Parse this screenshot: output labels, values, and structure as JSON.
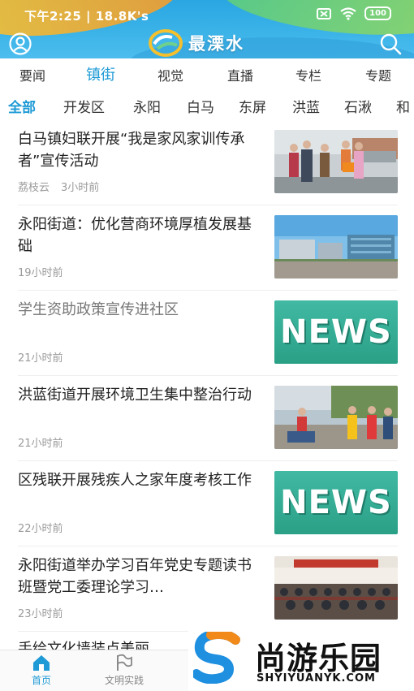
{
  "status": {
    "text": "下午2:25 | 18.8K's",
    "battery": "100"
  },
  "brand": {
    "name": "最溧水"
  },
  "channels": [
    {
      "label": "要闻"
    },
    {
      "label": "镇街"
    },
    {
      "label": "视觉"
    },
    {
      "label": "直播"
    },
    {
      "label": "专栏"
    },
    {
      "label": "专题"
    }
  ],
  "active_channel": "镇街",
  "areas": [
    {
      "label": "全部"
    },
    {
      "label": "开发区"
    },
    {
      "label": "永阳"
    },
    {
      "label": "白马"
    },
    {
      "label": "东屏"
    },
    {
      "label": "洪蓝"
    },
    {
      "label": "石湫"
    },
    {
      "label": "和"
    }
  ],
  "active_area": "全部",
  "articles": [
    {
      "title": "白马镇妇联开展“我是家风家训传承者”宣传活动",
      "source": "荔枝云",
      "time": "3小时前",
      "thumb": "photo-street"
    },
    {
      "title": "永阳街道：优化营商环境厚植发展基础",
      "source": "",
      "time": "19小时前",
      "thumb": "photo-buildings"
    },
    {
      "title": "学生资助政策宣传进社区",
      "source": "",
      "time": "21小时前",
      "thumb": "news-icon"
    },
    {
      "title": "洪蓝街道开展环境卫生集中整治行动",
      "source": "",
      "time": "21小时前",
      "thumb": "photo-volunteers"
    },
    {
      "title": "区残联开展残疾人之家年度考核工作",
      "source": "",
      "time": "22小时前",
      "thumb": "news-icon"
    },
    {
      "title": "永阳街道举办学习百年党史专题读书班暨党工委理论学习…",
      "source": "",
      "time": "23小时前",
      "thumb": "photo-meeting"
    }
  ],
  "partial_article_title": "手绘文化墙装点美丽",
  "news_label": "NEWS",
  "bottom_nav": [
    {
      "label": "首页"
    },
    {
      "label": "文明实践"
    }
  ],
  "watermark": {
    "cn": "尚游乐园",
    "en": "SHYIYUANYK.COM"
  },
  "colors": {
    "accent": "#1e9ad6",
    "header": "#3bb3e8",
    "news_bg": "#2aa086"
  }
}
